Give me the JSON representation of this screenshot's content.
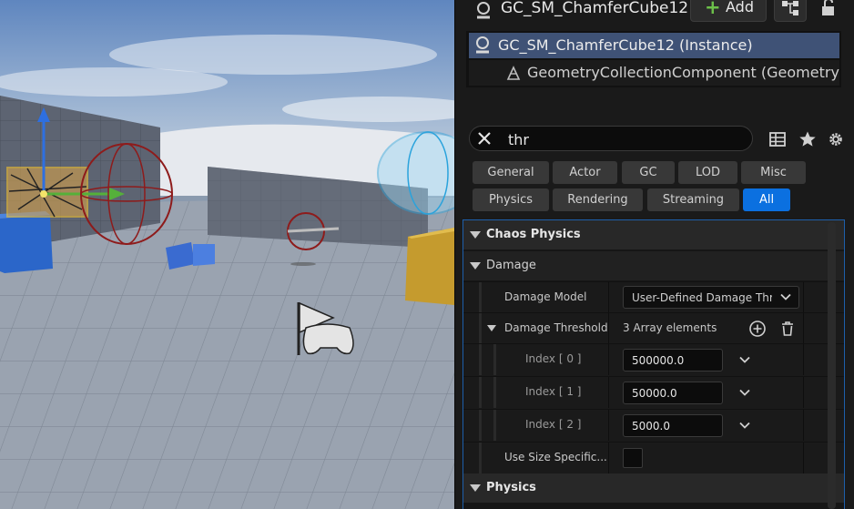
{
  "header": {
    "actor_title": "GC_SM_ChamferCube12",
    "add_label": "Add"
  },
  "tree": {
    "instance_label": "GC_SM_ChamferCube12 (Instance)",
    "component_label": "GeometryCollectionComponent (GeometryCollectionComponent)"
  },
  "search": {
    "value": "thr"
  },
  "filters": [
    {
      "label": "General"
    },
    {
      "label": "Actor"
    },
    {
      "label": "GC"
    },
    {
      "label": "LOD"
    },
    {
      "label": "Misc"
    },
    {
      "label": "Physics"
    },
    {
      "label": "Rendering"
    },
    {
      "label": "Streaming"
    },
    {
      "label": "All",
      "active": true
    }
  ],
  "details": {
    "category_chaos": "Chaos Physics",
    "subcategory_damage": "Damage",
    "damage_model_label": "Damage Model",
    "damage_model_value": "User-Defined Damage Threshold",
    "damage_threshold_label": "Damage Threshold",
    "damage_threshold_count": "3 Array elements",
    "index_rows": [
      {
        "label": "Index [ 0 ]",
        "value": "500000.0"
      },
      {
        "label": "Index [ 1 ]",
        "value": "50000.0"
      },
      {
        "label": "Index [ 2 ]",
        "value": "5000.0"
      }
    ],
    "use_size_label": "Use Size Specific...",
    "category_physics": "Physics"
  },
  "colors": {
    "accent": "#0b70e0",
    "selection": "#3f5276",
    "add_plus": "#6cc04a"
  }
}
